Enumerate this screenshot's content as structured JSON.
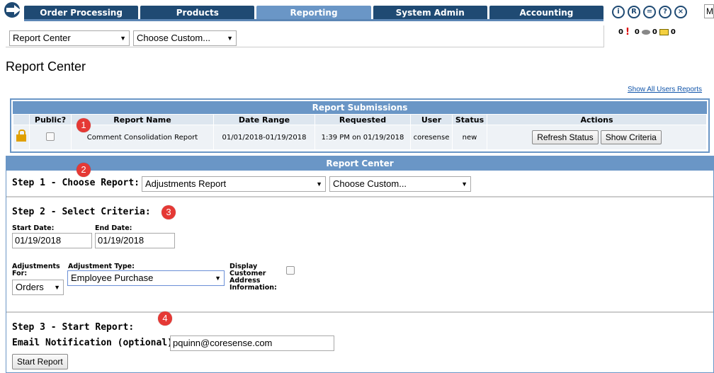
{
  "nav": {
    "tabs": [
      {
        "label": "Order Processing",
        "active": false
      },
      {
        "label": "Products",
        "active": false
      },
      {
        "label": "Reporting",
        "active": true
      },
      {
        "label": "System Admin",
        "active": false
      },
      {
        "label": "Accounting",
        "active": false
      }
    ],
    "icons": [
      "info-icon",
      "registered-icon",
      "print-icon",
      "help-icon",
      "close-icon"
    ],
    "icon_glyphs": [
      "i",
      "R",
      "=",
      "?",
      "×"
    ],
    "m_box": "M",
    "counts": {
      "alerts": "0",
      "messages": "0",
      "mail": "0",
      "mail_zero": "0"
    }
  },
  "sub_nav": {
    "report_select": "Report Center",
    "custom_select": "Choose Custom..."
  },
  "page_title": "Report Center",
  "show_all_users_link": "Show All Users Reports",
  "submissions": {
    "title": "Report Submissions",
    "columns": [
      "",
      "Public?",
      "Report Name",
      "Date Range",
      "Requested",
      "User",
      "Status",
      "Actions"
    ],
    "rows": [
      {
        "report_name": "Comment Consolidation Report",
        "date_range": "01/01/2018-01/19/2018",
        "requested": "1:39 PM on 01/19/2018",
        "user": "coresense",
        "status": "new",
        "actions": [
          "Refresh Status",
          "Show Criteria"
        ]
      }
    ]
  },
  "report_center": {
    "title": "Report Center",
    "step1": {
      "label": "Step 1 - Choose Report:",
      "report": "Adjustments Report",
      "custom": "Choose Custom..."
    },
    "step2": {
      "label": "Step 2 - Select Criteria:",
      "start_date_label": "Start Date:",
      "start_date": "01/19/2018",
      "end_date_label": "End Date:",
      "end_date": "01/19/2018",
      "adjustments_for_label": "Adjustments For:",
      "adjustments_for": "Orders",
      "adjustment_type_label": "Adjustment Type:",
      "adjustment_type": "Employee Purchase",
      "display_customer_label": "Display Customer Address Information:"
    },
    "step3": {
      "label": "Step 3 - Start Report:",
      "email_label": "Email Notification (optional):",
      "email": "pquinn@coresense.com",
      "start_button": "Start Report"
    }
  },
  "markers": [
    "1",
    "2",
    "3",
    "4"
  ],
  "colors": {
    "nav_dark": "#1f4a73",
    "nav_active": "#6a96c6",
    "header_blue": "#6a96c6",
    "marker_red": "#e53935"
  }
}
